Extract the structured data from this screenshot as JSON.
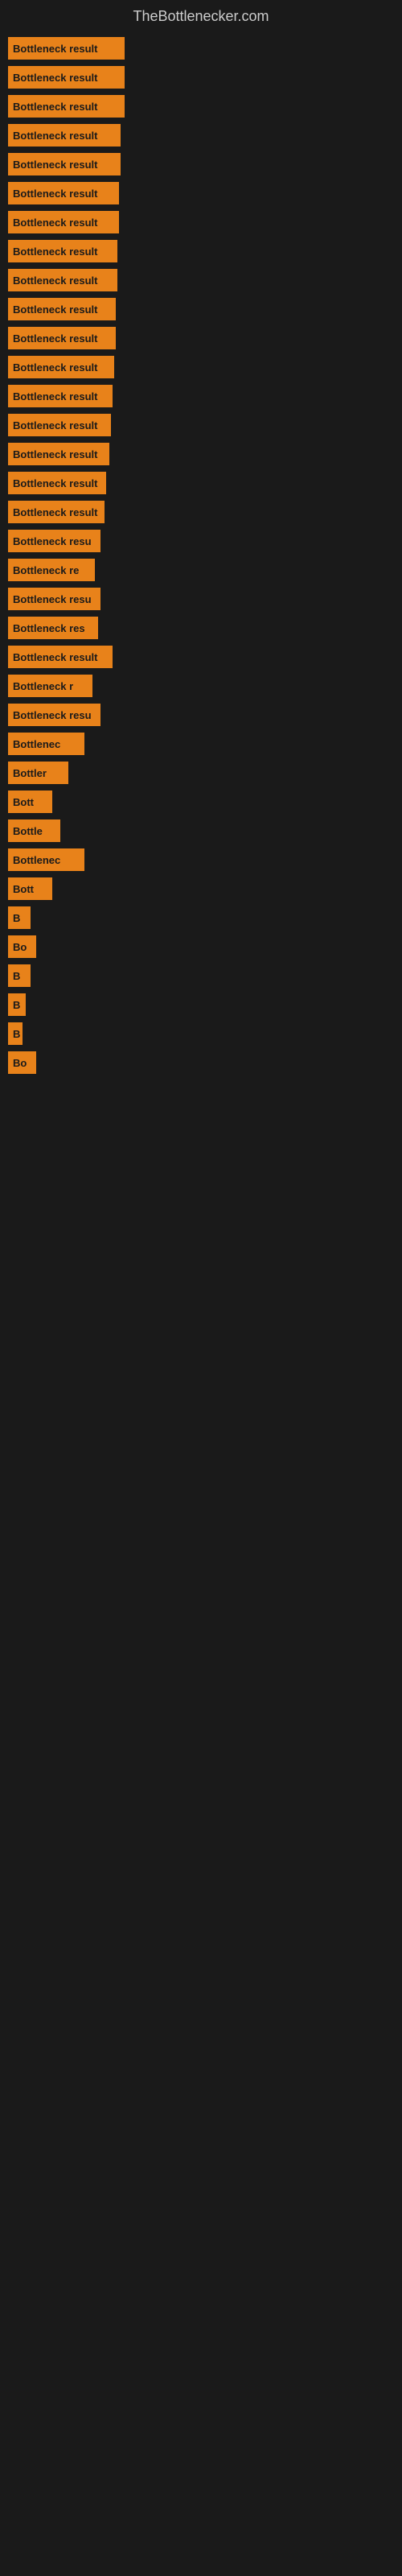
{
  "site": {
    "title": "TheBottlenecker.com"
  },
  "bars": [
    {
      "label": "Bottleneck result",
      "width": 145
    },
    {
      "label": "Bottleneck result",
      "width": 145
    },
    {
      "label": "Bottleneck result",
      "width": 145
    },
    {
      "label": "Bottleneck result",
      "width": 140
    },
    {
      "label": "Bottleneck result",
      "width": 140
    },
    {
      "label": "Bottleneck result",
      "width": 138
    },
    {
      "label": "Bottleneck result",
      "width": 138
    },
    {
      "label": "Bottleneck result",
      "width": 136
    },
    {
      "label": "Bottleneck result",
      "width": 136
    },
    {
      "label": "Bottleneck result",
      "width": 134
    },
    {
      "label": "Bottleneck result",
      "width": 134
    },
    {
      "label": "Bottleneck result",
      "width": 132
    },
    {
      "label": "Bottleneck result",
      "width": 130
    },
    {
      "label": "Bottleneck result",
      "width": 128
    },
    {
      "label": "Bottleneck result",
      "width": 126
    },
    {
      "label": "Bottleneck result",
      "width": 122
    },
    {
      "label": "Bottleneck result",
      "width": 120
    },
    {
      "label": "Bottleneck resu",
      "width": 115
    },
    {
      "label": "Bottleneck re",
      "width": 108
    },
    {
      "label": "Bottleneck resu",
      "width": 115
    },
    {
      "label": "Bottleneck res",
      "width": 112
    },
    {
      "label": "Bottleneck result",
      "width": 130
    },
    {
      "label": "Bottleneck r",
      "width": 105
    },
    {
      "label": "Bottleneck resu",
      "width": 115
    },
    {
      "label": "Bottlenec",
      "width": 95
    },
    {
      "label": "Bottler",
      "width": 75
    },
    {
      "label": "Bott",
      "width": 55
    },
    {
      "label": "Bottle",
      "width": 65
    },
    {
      "label": "Bottlenec",
      "width": 95
    },
    {
      "label": "Bott",
      "width": 55
    },
    {
      "label": "B",
      "width": 28
    },
    {
      "label": "Bo",
      "width": 35
    },
    {
      "label": "B",
      "width": 28
    },
    {
      "label": "B",
      "width": 22
    },
    {
      "label": "B",
      "width": 18
    },
    {
      "label": "Bo",
      "width": 35
    }
  ],
  "colors": {
    "background": "#1a1a1a",
    "bar": "#e8821a",
    "title": "#cccccc"
  }
}
